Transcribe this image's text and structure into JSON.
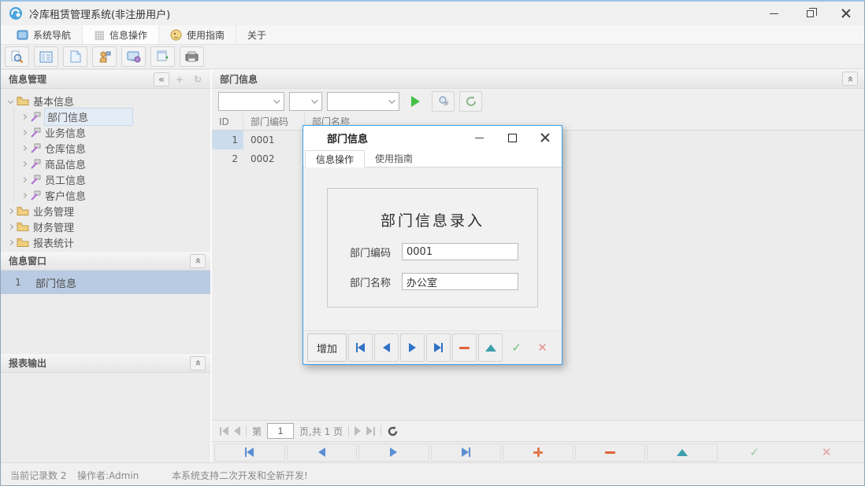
{
  "window": {
    "title": "冷库租赁管理系统(非注册用户)"
  },
  "menu": {
    "items": [
      {
        "label": "系统导航",
        "icon": "monitor-icon"
      },
      {
        "label": "信息操作",
        "icon": "grid-icon"
      },
      {
        "label": "使用指南",
        "icon": "clock-icon"
      },
      {
        "label": "关于",
        "icon": "none"
      }
    ]
  },
  "toolbar": {
    "buttons": [
      "search-preview",
      "table-list",
      "document",
      "user",
      "monitor-globe",
      "window-add",
      "printer"
    ]
  },
  "sidebar": {
    "panels": {
      "info_manage": "信息管理",
      "info_window": "信息窗口",
      "report_output": "报表输出"
    },
    "glyphs": {
      "collapse_left": "«",
      "add": "+",
      "refresh": "↻",
      "collapse_up": "«"
    },
    "tree": {
      "items": [
        {
          "label": "基本信息",
          "type": "folder",
          "state": "expanded"
        },
        {
          "label": "部门信息",
          "type": "module",
          "selected": true
        },
        {
          "label": "业务信息",
          "type": "module"
        },
        {
          "label": "仓库信息",
          "type": "module"
        },
        {
          "label": "商品信息",
          "type": "module"
        },
        {
          "label": "员工信息",
          "type": "module"
        },
        {
          "label": "客户信息",
          "type": "module"
        },
        {
          "label": "业务管理",
          "type": "folder",
          "state": "collapsed"
        },
        {
          "label": "财务管理",
          "type": "folder",
          "state": "collapsed"
        },
        {
          "label": "报表统计",
          "type": "folder",
          "state": "collapsed"
        }
      ]
    },
    "window_list": [
      {
        "index": "1",
        "label": "部门信息",
        "selected": true
      }
    ]
  },
  "main": {
    "header": "部门信息",
    "table": {
      "columns": [
        "ID",
        "部门编码",
        "部门名称"
      ],
      "rows": [
        {
          "id": "1",
          "code": "0001",
          "name": "",
          "selected": true
        },
        {
          "id": "2",
          "code": "0002",
          "name": "",
          "selected": false
        }
      ]
    },
    "pagination": {
      "prefix": "第",
      "page": "1",
      "suffix": "页,共 1 页"
    }
  },
  "dialog": {
    "title": "部门信息",
    "tabs": [
      {
        "label": "信息操作",
        "active": true
      },
      {
        "label": "使用指南",
        "active": false
      }
    ],
    "form": {
      "title": "部门信息录入",
      "fields": [
        {
          "label": "部门编码",
          "value": "0001"
        },
        {
          "label": "部门名称",
          "value": "办公室"
        }
      ]
    },
    "add_button": "增加"
  },
  "statusbar": {
    "record_count": "当前记录数 2",
    "operator": "操作者:Admin",
    "message": "本系统支持二次开发和全新开发!"
  },
  "colors": {
    "accent_blue": "#3da0e8",
    "nav_arrow_blue": "#5b8fd4",
    "play_green": "#45c145",
    "plus_orange": "#e0784a",
    "minus_red": "#e2603a",
    "teal": "#3d9fae",
    "check_green": "#6cbf7e",
    "x_red": "#e88f8f",
    "selection_blue": "#b9cbe2",
    "cell_selection": "#ccdcec"
  }
}
